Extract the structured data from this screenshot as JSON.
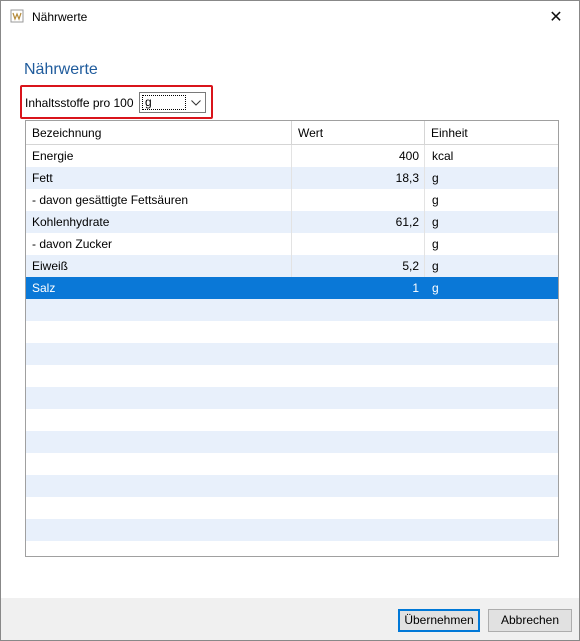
{
  "window": {
    "title": "Nährwerte",
    "close_glyph": "✕",
    "icon": "app-icon"
  },
  "heading": "Nährwerte",
  "unit": {
    "label": "Inhaltsstoffe pro 100",
    "value": "g",
    "arrow_glyph": "⌵"
  },
  "table": {
    "columns": [
      "Bezeichnung",
      "Wert",
      "Einheit"
    ],
    "rows": [
      {
        "name": "Energie",
        "value": "400",
        "unit": "kcal"
      },
      {
        "name": "Fett",
        "value": "18,3",
        "unit": "g"
      },
      {
        "name": "- davon gesättigte Fettsäuren",
        "value": "",
        "unit": "g"
      },
      {
        "name": "Kohlenhydrate",
        "value": "61,2",
        "unit": "g"
      },
      {
        "name": "- davon Zucker",
        "value": "",
        "unit": "g"
      },
      {
        "name": "Eiweiß",
        "value": "5,2",
        "unit": "g"
      },
      {
        "name": "Salz",
        "value": "1",
        "unit": "g",
        "selected": true
      }
    ]
  },
  "buttons": {
    "ok": "Übernehmen",
    "cancel": "Abbrechen"
  },
  "colors": {
    "heading": "#1f5b9c",
    "highlight": "#d9141b",
    "selection": "#0a78d7",
    "alt_row": "#e8f0fb"
  }
}
